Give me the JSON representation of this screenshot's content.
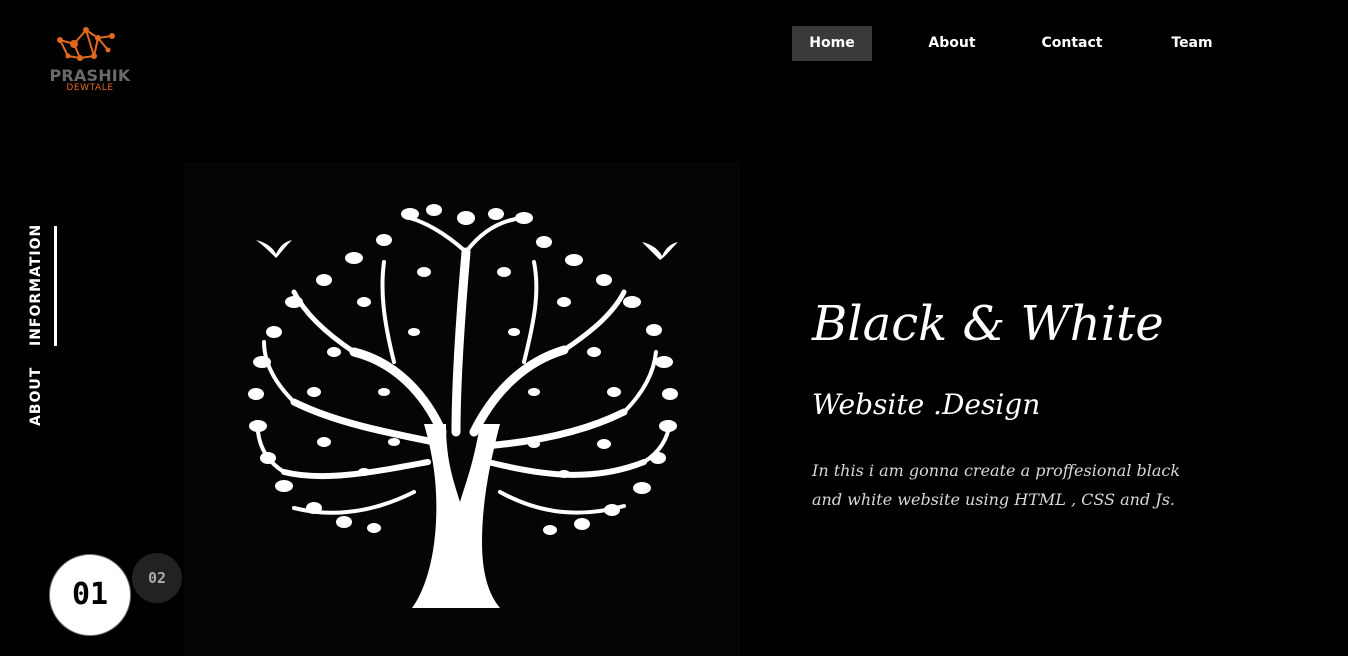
{
  "brand": {
    "name": "PRASHIK",
    "sub": "DEWTALE",
    "accent_color": "#e0691f",
    "name_color": "#6a6a6a"
  },
  "nav": {
    "items": [
      {
        "label": "Home",
        "active": true
      },
      {
        "label": "About",
        "active": false
      },
      {
        "label": "Contact",
        "active": false
      },
      {
        "label": "Team",
        "active": false
      }
    ]
  },
  "side_tabs": {
    "information": "INFORMATION",
    "about": "ABOUT"
  },
  "slides": {
    "current": "01",
    "next": "02"
  },
  "hero": {
    "image_icon": "tree-illustration-icon",
    "title": "Black & White",
    "subtitle": "Website .Design",
    "description": "In this i am gonna create a proffesional black and white website using HTML , CSS and Js."
  }
}
